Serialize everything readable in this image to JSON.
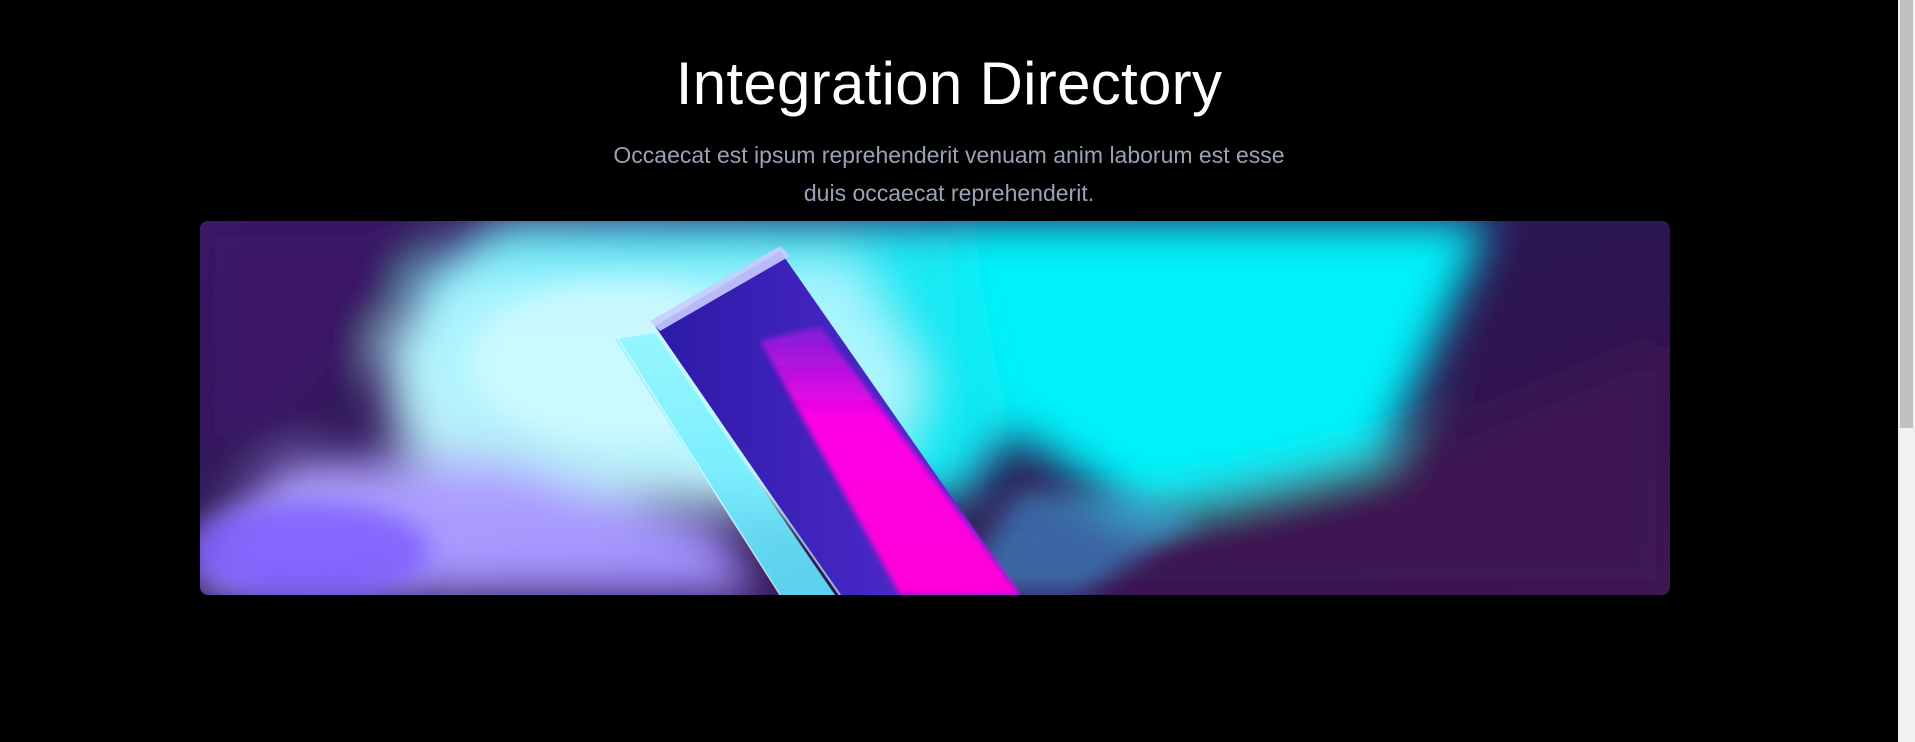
{
  "hero": {
    "title": "Integration Directory",
    "subtitle": "Occaecat est ipsum reprehenderit venuam anim laborum est esse duis occaecat reprehenderit."
  },
  "colors": {
    "background": "#000000",
    "title": "#ffffff",
    "subtitle": "#9aa2b8",
    "image_purple": "#2a1550",
    "image_cyan": "#00f0f8",
    "image_magenta": "#ff00e0",
    "image_violet": "#8a6cff"
  },
  "icons": {
    "hero_image": "abstract-neon-prism-image"
  }
}
